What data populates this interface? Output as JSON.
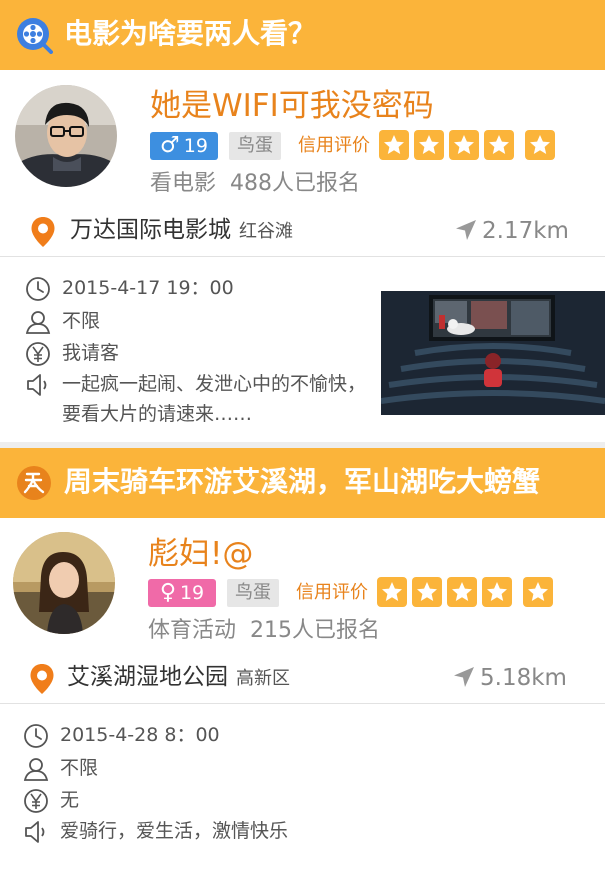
{
  "cards": [
    {
      "title": "电影为啥要两人看？",
      "user": {
        "name": "她是WIFI可我没密码",
        "sex_symbol": "♂",
        "age": "19",
        "level": "鸟蛋",
        "credit_label": "信用评价",
        "rating": 5
      },
      "activity_type": "看电影",
      "signup": "488人已报名",
      "place": "万达国际电影城",
      "district": "红谷滩",
      "distance": "2.17km",
      "time": "2015-4-17  19：00",
      "gender_limit": "不限",
      "payment": "我请客",
      "description": "一起疯一起闹、发泄心中的不愉快，要看大片的请速来……"
    },
    {
      "title": "周末骑车环游艾溪湖，军山湖吃大螃蟹",
      "user": {
        "name": "彪妇!@",
        "sex_symbol": "♀",
        "age": "19",
        "level": "鸟蛋",
        "credit_label": "信用评价",
        "rating": 5
      },
      "activity_type": "体育活动",
      "signup": "215人已报名",
      "place": "艾溪湖湿地公园",
      "district": "高新区",
      "distance": "5.18km",
      "time": "2015-4-28  8：00",
      "gender_limit": "不限",
      "payment": "无",
      "description": "爱骑行，爱生活，激情快乐"
    }
  ],
  "colors": {
    "accent": "#fbb43a",
    "name": "#e8831c",
    "male": "#3d8fe0",
    "female": "#f06aa8"
  },
  "icons": {
    "card1_category": "film-reel-search-icon",
    "card2_category": "bicycle-icon",
    "location": "location-pin-icon",
    "distance": "navigation-arrow-icon",
    "time": "clock-icon",
    "gender": "person-icon",
    "payment": "yen-icon",
    "description": "speaker-icon"
  }
}
